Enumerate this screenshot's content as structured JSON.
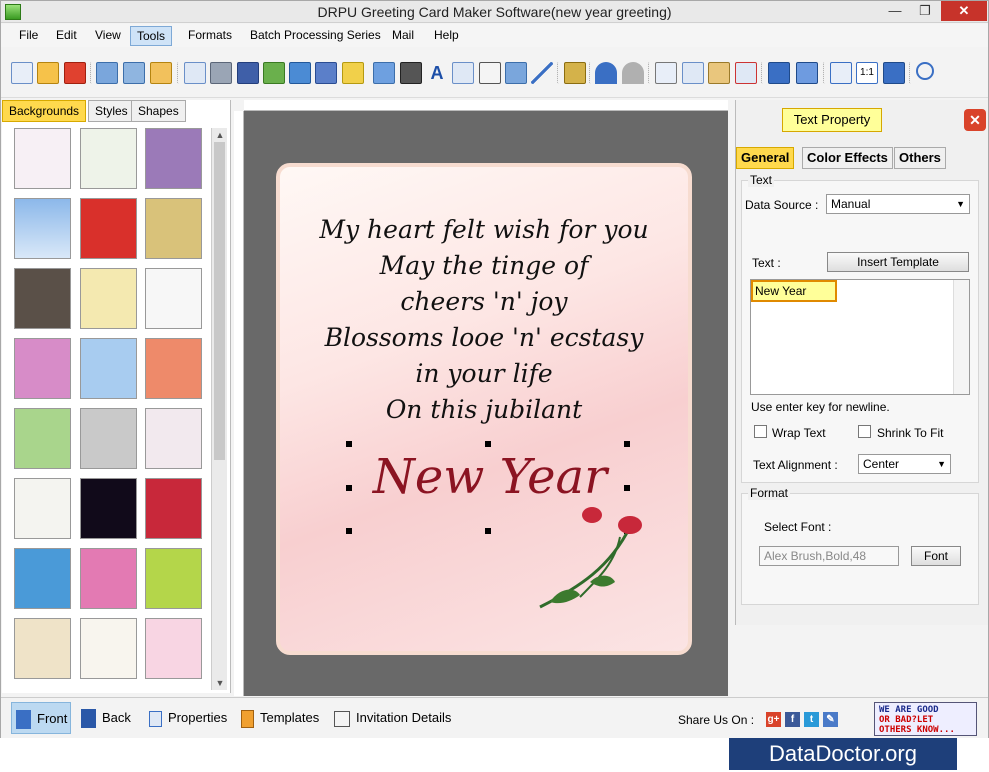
{
  "window": {
    "title": "DRPU Greeting Card Maker Software(new year greeting)"
  },
  "menu": [
    "File",
    "Edit",
    "View",
    "Tools",
    "Formats",
    "Batch Processing Series",
    "Mail",
    "Help"
  ],
  "left_tabs": [
    "Backgrounds",
    "Styles",
    "Shapes"
  ],
  "card": {
    "lines": [
      "My heart felt wish for you",
      "May the tinge of",
      "cheers 'n' joy",
      "Blossoms looe 'n' ecstasy",
      "in your life",
      "On this jubilant"
    ],
    "headline": "New Year"
  },
  "text_property": {
    "title": "Text Property",
    "tabs": [
      "General",
      "Color Effects",
      "Others"
    ],
    "text_group": "Text",
    "data_source_label": "Data Source :",
    "data_source_value": "Manual",
    "text_label": "Text :",
    "insert_template": "Insert Template",
    "text_value": "New Year",
    "hint": "Use enter key for newline.",
    "wrap_text": "Wrap Text",
    "shrink_to_fit": "Shrink To Fit",
    "alignment_label": "Text Alignment :",
    "alignment_value": "Center",
    "format_group": "Format",
    "select_font_label": "Select Font :",
    "font_value": "Alex Brush,Bold,48",
    "font_button": "Font"
  },
  "bottom": {
    "front": "Front",
    "back": "Back",
    "properties": "Properties",
    "templates": "Templates",
    "invitation": "Invitation Details",
    "share": "Share Us On :",
    "promo": [
      "WE ARE GOOD",
      "OR BAD?LET",
      "OTHERS KNOW..."
    ]
  },
  "watermark": "DataDoctor.org"
}
